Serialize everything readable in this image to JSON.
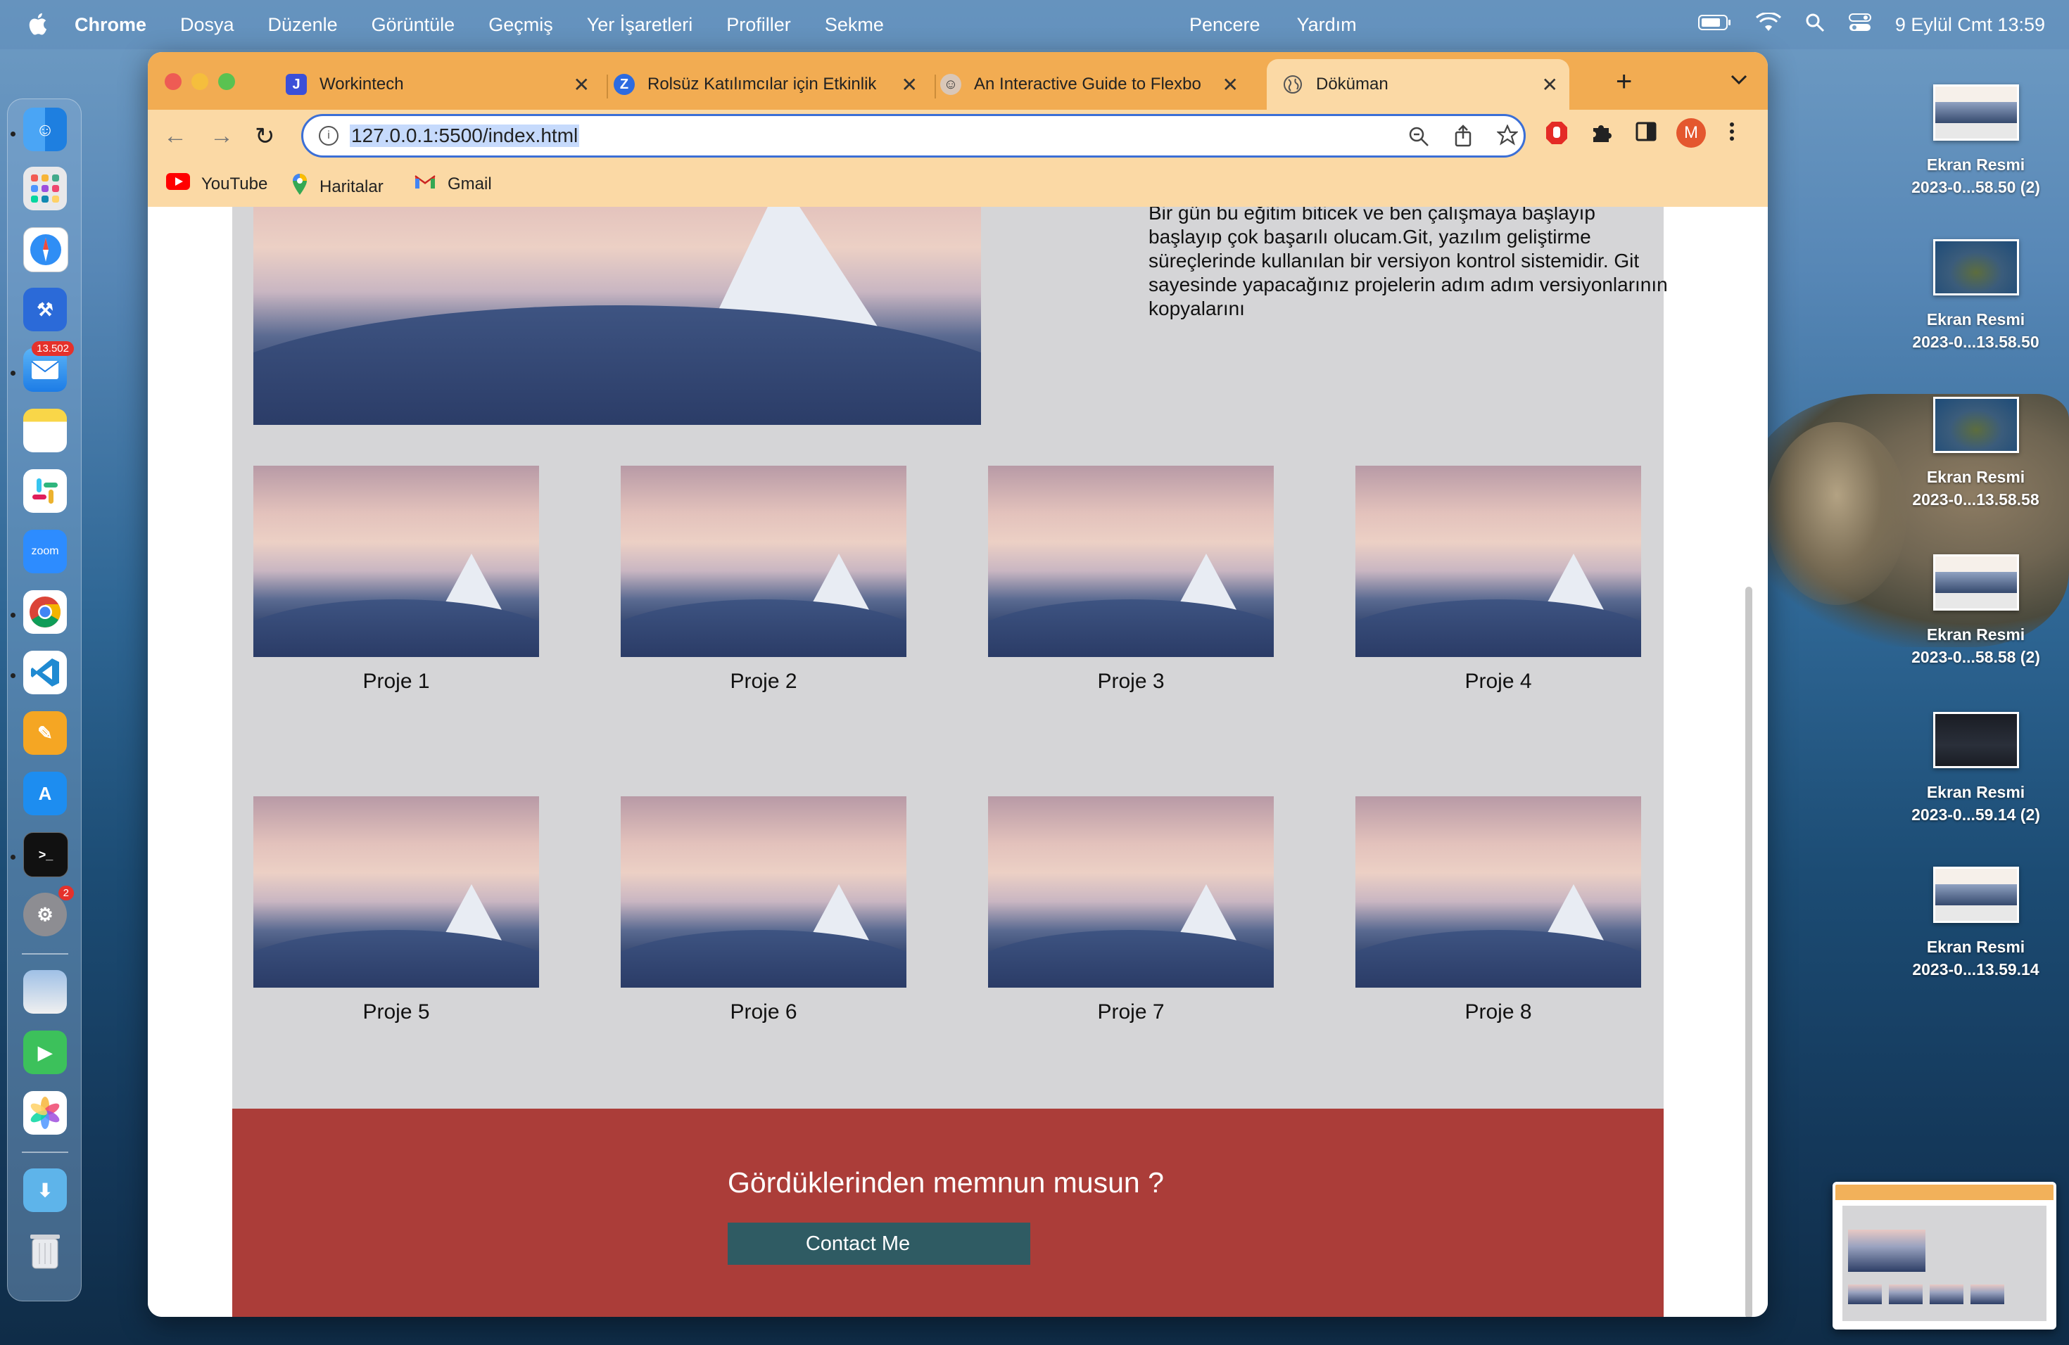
{
  "menubar": {
    "app_name": "Chrome",
    "menus": [
      "Dosya",
      "Düzenle",
      "Görüntüle",
      "Geçmiş",
      "Yer İşaretleri",
      "Profiller",
      "Sekme"
    ],
    "menus_right": [
      "Pencere",
      "Yardım"
    ],
    "clock": "9 Eylül Cmt  13:59"
  },
  "dock": {
    "mail_badge": "13.502",
    "settings_badge": "2",
    "zoom_label": "zoom"
  },
  "desktop": {
    "files": [
      {
        "line1": "Ekran Resmi",
        "line2": "2023-0...58.50 (2)"
      },
      {
        "line1": "Ekran Resmi",
        "line2": "2023-0...13.58.50"
      },
      {
        "line1": "Ekran Resmi",
        "line2": "2023-0...13.58.58"
      },
      {
        "line1": "Ekran Resmi",
        "line2": "2023-0...58.58 (2)"
      },
      {
        "line1": "Ekran Resmi",
        "line2": "2023-0...59.14 (2)"
      },
      {
        "line1": "Ekran Resmi",
        "line2": "2023-0...13.59.14"
      }
    ]
  },
  "browser": {
    "tabs": [
      {
        "title": "Workintech",
        "icon": "workintech-icon"
      },
      {
        "title": "Rolsüz Katılımcılar için Etkinlik",
        "icon": "zoom-z-icon"
      },
      {
        "title": "An Interactive Guide to Flexbo",
        "icon": "avatar-icon"
      },
      {
        "title": "Döküman",
        "icon": "globe-icon",
        "active": true
      }
    ],
    "url": "127.0.0.1:5500/index.html",
    "profile_initial": "M",
    "bookmarks": [
      {
        "label": "YouTube",
        "icon": "youtube-icon"
      },
      {
        "label": "Haritalar",
        "icon": "maps-icon"
      },
      {
        "label": "Gmail",
        "icon": "gmail-icon"
      }
    ],
    "accent_color": "#f2ac52"
  },
  "page": {
    "hero_text": "Bir gün bu eğitim biticek ve ben çalışmaya başlayıp başlayıp çok başarılı olucam.Git, yazılım geliştirme süreçlerinde kullanılan bir versiyon kontrol sistemidir. Git sayesinde yapacağınız projelerin adım adım versiyonlarının kopyalarını",
    "projects": [
      "Proje 1",
      "Proje 2",
      "Proje 3",
      "Proje 4",
      "Proje 5",
      "Proje 6",
      "Proje 7",
      "Proje 8"
    ],
    "footer_question": "Gördüklerinden memnun musun ?",
    "contact_button": "Contact Me",
    "footer_color": "#ab3d39",
    "button_color": "#2f5b63"
  }
}
